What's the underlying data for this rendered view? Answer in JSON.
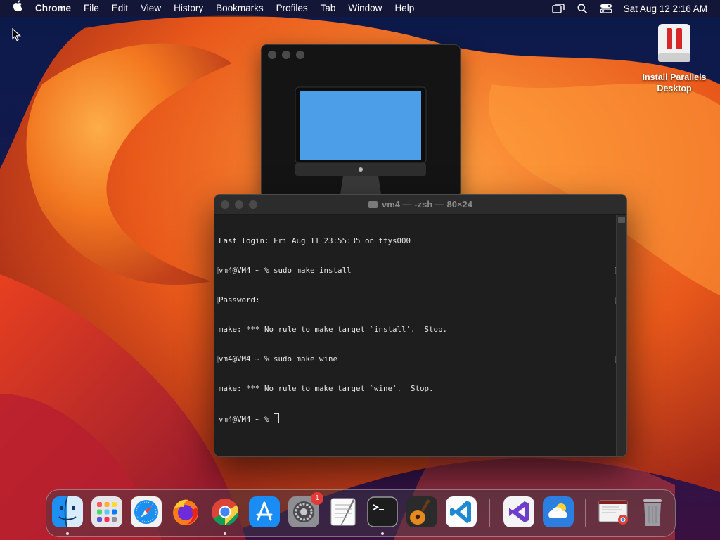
{
  "menubar": {
    "app": "Chrome",
    "items": [
      "File",
      "Edit",
      "View",
      "History",
      "Bookmarks",
      "Profiles",
      "Tab",
      "Window",
      "Help"
    ],
    "clock": "Sat Aug 12  2:16 AM"
  },
  "desktop_icon": {
    "line1": "Install Parallels",
    "line2": "Desktop"
  },
  "terminal": {
    "title": "vm4 — -zsh — 80×24",
    "lines": [
      "Last login: Fri Aug 11 23:55:35 on ttys000",
      "vm4@VM4 ~ % sudo make install",
      "Password:",
      "make: *** No rule to make target `install'.  Stop.",
      "vm4@VM4 ~ % sudo make wine",
      "make: *** No rule to make target `wine'.  Stop.",
      "vm4@VM4 ~ % "
    ]
  },
  "dock": {
    "badge": "1",
    "apps": [
      "finder",
      "launchpad",
      "safari",
      "firefox",
      "chrome",
      "app-store",
      "system-settings",
      "textedit",
      "terminal",
      "garageband",
      "vscode",
      "visual-studio",
      "weather",
      "chrome-window-preview",
      "trash"
    ]
  },
  "colors": {
    "terminal_bg": "#1e1e1e",
    "menubar_text": "#ffffff",
    "parallels_red": "#d62828"
  }
}
